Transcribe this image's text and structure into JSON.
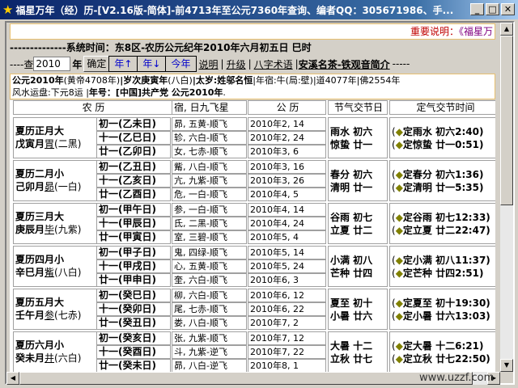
{
  "title": "福星万年（经）历-[V2.16版-简体]-前4713年至公元7360年查询、编者QQ：305671986、手...",
  "banner": {
    "label": "重要说明：",
    "link": "《福星万"
  },
  "systime": "--------------系统时间：东8区-农历公元纪年2010年六月初五日 巳时",
  "query": {
    "prefix": "----查",
    "year_value": "2010",
    "year_suffix": "年",
    "confirm": "确定",
    "year_up": "年↑",
    "year_down": "年↓",
    "this_year": "今年",
    "links": [
      "说明",
      "升级",
      "八字术语"
    ],
    "tea_link": "安溪名茶-铁观音简介",
    "suffix": "-----"
  },
  "info": {
    "line1": [
      "公元2010年",
      "(黄帝4708年)",
      "|岁次庚寅年",
      "(八白)",
      "|太岁:",
      "姓邬名恒",
      "|年宿:牛(局:壁)|道4077年|佛2554年"
    ],
    "line2": [
      "风水运盘:下元8运 |",
      "年号：[中国]共产党 公元2010年",
      "."
    ]
  },
  "headers": [
    "农 历",
    "宿, 日九飞星",
    "公 历",
    "节气交节日",
    "定气交节时间"
  ],
  "months": [
    {
      "name": "夏历正月大",
      "gz": "戊寅月",
      "xiu": "胃",
      "star": "(二黑)",
      "days": [
        "初一(乙未日)",
        "十一(乙巳日)",
        "廿一(乙卯日)"
      ],
      "stars": [
        "昴, 五黄-顺飞",
        "轸, 六白-顺飞",
        "女, 七赤-顺飞"
      ],
      "dates": [
        "2010年2, 14",
        "2010年2, 24",
        "2010年3, 6"
      ],
      "terms": [
        "雨水  初六",
        "惊蛰  廿一"
      ],
      "times": [
        "定雨水  初六2:40)",
        "定惊蛰  廿一0:51)"
      ]
    },
    {
      "name": "夏历二月小",
      "gz": "己卯月",
      "xiu": "昴",
      "star": "(一白)",
      "days": [
        "初一(乙丑日)",
        "十一(乙亥日)",
        "廿一(乙酉日)"
      ],
      "stars": [
        "觜, 八白-顺飞",
        "亢, 九紫-顺飞",
        "危, 一白-顺飞"
      ],
      "dates": [
        "2010年3, 16",
        "2010年3, 26",
        "2010年4, 5"
      ],
      "terms": [
        "春分  初六",
        "清明  廿一"
      ],
      "times": [
        "定春分  初六1:36)",
        "定清明  廿一5:35)"
      ]
    },
    {
      "name": "夏历三月大",
      "gz": "庚辰月",
      "xiu": "毕",
      "star": "(九紫)",
      "days": [
        "初一(甲午日)",
        "十一(甲辰日)",
        "廿一(甲寅日)"
      ],
      "stars": [
        "参, 一白-顺飞",
        "氐, 二黑-顺飞",
        "室, 三碧-顺飞"
      ],
      "dates": [
        "2010年4, 14",
        "2010年4, 24",
        "2010年5, 4"
      ],
      "terms": [
        "谷雨  初七",
        "立夏  廿二"
      ],
      "times": [
        "定谷雨  初七12:33)",
        "定立夏  廿二22:47)"
      ]
    },
    {
      "name": "夏历四月小",
      "gz": "辛巳月",
      "xiu": "觜",
      "star": "(八白)",
      "days": [
        "初一(甲子日)",
        "十一(甲戌日)",
        "廿一(甲申日)"
      ],
      "stars": [
        "鬼, 四绿-顺飞",
        "心, 五黄-顺飞",
        "奎, 六白-顺飞"
      ],
      "dates": [
        "2010年5, 14",
        "2010年5, 24",
        "2010年6, 3"
      ],
      "terms": [
        "小满  初八",
        "芒种  廿四"
      ],
      "times": [
        "定小满  初八11:37)",
        "定芒种  廿四2:51)"
      ]
    },
    {
      "name": "夏历五月大",
      "gz": "壬午月",
      "xiu": "参",
      "star": "(七赤)",
      "days": [
        "初一(癸巳日)",
        "十一(癸卯日)",
        "廿一(癸丑日)"
      ],
      "stars": [
        "柳, 六白-顺飞",
        "尾, 七赤-顺飞",
        "娄, 八白-顺飞"
      ],
      "dates": [
        "2010年6, 12",
        "2010年6, 22",
        "2010年7, 2"
      ],
      "terms": [
        "夏至  初十",
        "小暑  廿六"
      ],
      "times": [
        "定夏至  初十19:30)",
        "定小暑  廿六13:03)"
      ]
    },
    {
      "name": "夏历六月小",
      "gz": "癸未月",
      "xiu": "井",
      "star": "(六白)",
      "days": [
        "初一(癸亥日)",
        "十一(癸酉日)",
        "廿一(癸未日)"
      ],
      "stars": [
        "张, 九紫-顺飞",
        "斗, 九紫-逆飞",
        "昴, 八白-逆飞"
      ],
      "dates": [
        "2010年7, 12",
        "2010年7, 22",
        "2010年8, 1"
      ],
      "terms": [
        "大暑  十二",
        "立秋  廿七"
      ],
      "times": [
        "定大暑  十二6:21)",
        "定立秋  廿七22:50)"
      ]
    }
  ],
  "watermark": "www.uzzf.com"
}
